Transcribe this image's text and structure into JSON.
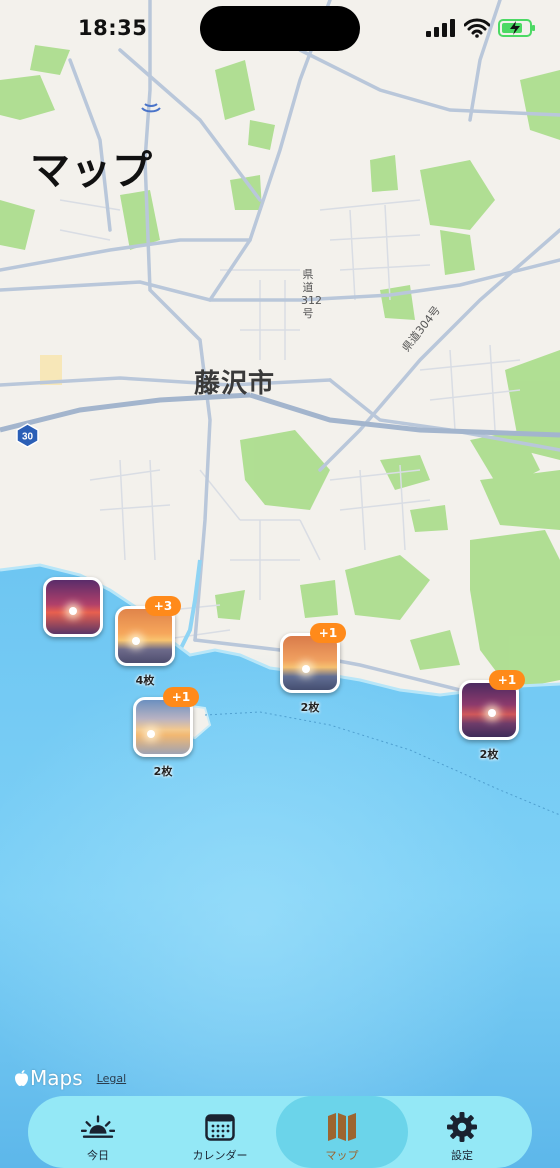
{
  "status_bar": {
    "time": "18:35"
  },
  "page": {
    "title": "マップ"
  },
  "map": {
    "city_label": "藤沢市",
    "road_labels": [
      "県道312号",
      "県道304号"
    ],
    "route_shield": "30",
    "colors": {
      "land": "#f3f1ec",
      "park": "#a9dd8a",
      "road": "#b9c7da",
      "sea": "#6ec6f2"
    }
  },
  "photo_pins": [
    {
      "badge": "",
      "count": "",
      "theme": "purple-sunset"
    },
    {
      "badge": "+3",
      "count": "4枚",
      "theme": "orange-sunset"
    },
    {
      "badge": "+1",
      "count": "2枚",
      "theme": "pale-sunset"
    },
    {
      "badge": "+1",
      "count": "2枚",
      "theme": "orange-sunset"
    },
    {
      "badge": "+1",
      "count": "2枚",
      "theme": "purple-sunset"
    }
  ],
  "attribution": {
    "maps_label": "Maps",
    "legal_label": "Legal"
  },
  "tab_bar": {
    "active": "map",
    "items": [
      {
        "id": "today",
        "label": "今日",
        "icon": "sunrise-icon"
      },
      {
        "id": "calendar",
        "label": "カレンダー",
        "icon": "calendar-icon"
      },
      {
        "id": "map",
        "label": "マップ",
        "icon": "map-icon"
      },
      {
        "id": "settings",
        "label": "設定",
        "icon": "gear-icon"
      }
    ]
  },
  "colors": {
    "badge": "#ff8a1a",
    "tab_bar": "#94e8f6",
    "tab_active": "#6bd4ea",
    "tab_active_icon": "#9c6530"
  }
}
